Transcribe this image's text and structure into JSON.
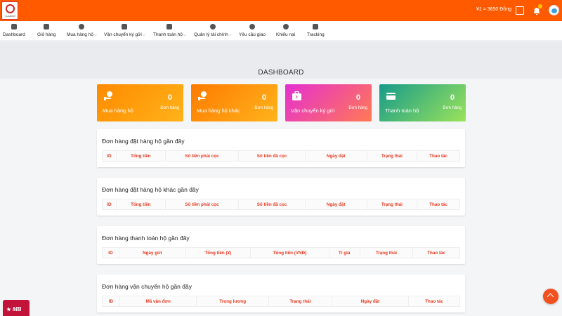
{
  "header": {
    "logo_text": "CHAMORY",
    "exchange_rate": "¥1 = 3650 Đồng"
  },
  "nav": {
    "items": [
      {
        "label": "Dashboard",
        "icon": "grid-icon"
      },
      {
        "label": "Giỏ hàng",
        "icon": "cart-icon"
      },
      {
        "label": "Mua hàng hộ",
        "icon": "user-bag-icon",
        "dropdown": true
      },
      {
        "label": "Vận chuyển ký gửi",
        "icon": "briefcase-icon",
        "dropdown": true
      },
      {
        "label": "Thanh toán hộ",
        "icon": "credit-card-icon",
        "dropdown": true
      },
      {
        "label": "Quản lý tài chính",
        "icon": "dollar-icon",
        "dropdown": true
      },
      {
        "label": "Yêu cầu giao",
        "icon": "info-icon"
      },
      {
        "label": "Khiếu nại",
        "icon": "alert-icon"
      },
      {
        "label": "Tracking",
        "icon": "truck-icon"
      }
    ]
  },
  "page_title": "DASHBOARD",
  "cards": [
    {
      "label": "Mua hàng hộ",
      "count": "0",
      "unit": "Đơn hàng",
      "icon": "hand-box-icon",
      "gradient": [
        "#ff8a00",
        "#ffb31a"
      ]
    },
    {
      "label": "Mua hàng hộ khác",
      "count": "0",
      "unit": "Đơn hàng",
      "icon": "hand-box-icon",
      "gradient": [
        "#ff7a00",
        "#ffb41c"
      ]
    },
    {
      "label": "Vận chuyển ký gửi",
      "count": "0",
      "unit": "Đơn hàng",
      "icon": "briefcase-icon",
      "gradient": [
        "#e52fd0",
        "#ff7a54"
      ]
    },
    {
      "label": "Thanh toán hộ",
      "count": "0",
      "unit": "Đơn hàng",
      "icon": "credit-card-icon",
      "gradient": [
        "#169b8a",
        "#9be35a"
      ]
    }
  ],
  "panels": [
    {
      "title": "Đơn hàng đặt hàng hộ gần đây",
      "columns": [
        "ID",
        "Tổng tiền",
        "Số tiền phải cọc",
        "Số tiền đã cọc",
        "Ngày đặt",
        "Trạng thái",
        "Thao tác"
      ]
    },
    {
      "title": "Đơn hàng đặt hàng hộ khác gần đây",
      "columns": [
        "ID",
        "Tổng tiền",
        "Số tiền phải cọc",
        "Số tiền đã cọc",
        "Ngày đặt",
        "Trạng thái",
        "Thao tác"
      ]
    },
    {
      "title": "Đơn hàng thanh toán hộ gần đây",
      "columns": [
        "ID",
        "Ngày gửi",
        "Tổng tiền (¥)",
        "Tổng tiền (VNĐ)",
        "Tỉ giá",
        "Trạng thái",
        "Thao tác"
      ]
    },
    {
      "title": "Đơn hàng vận chuyển hộ gần đây",
      "columns": [
        "ID",
        "Mã vận đơn",
        "Trọng lượng",
        "Trạng thái",
        "Ngày đặt",
        "Thao tác"
      ]
    }
  ],
  "floating": {
    "mb_label": "MB"
  }
}
